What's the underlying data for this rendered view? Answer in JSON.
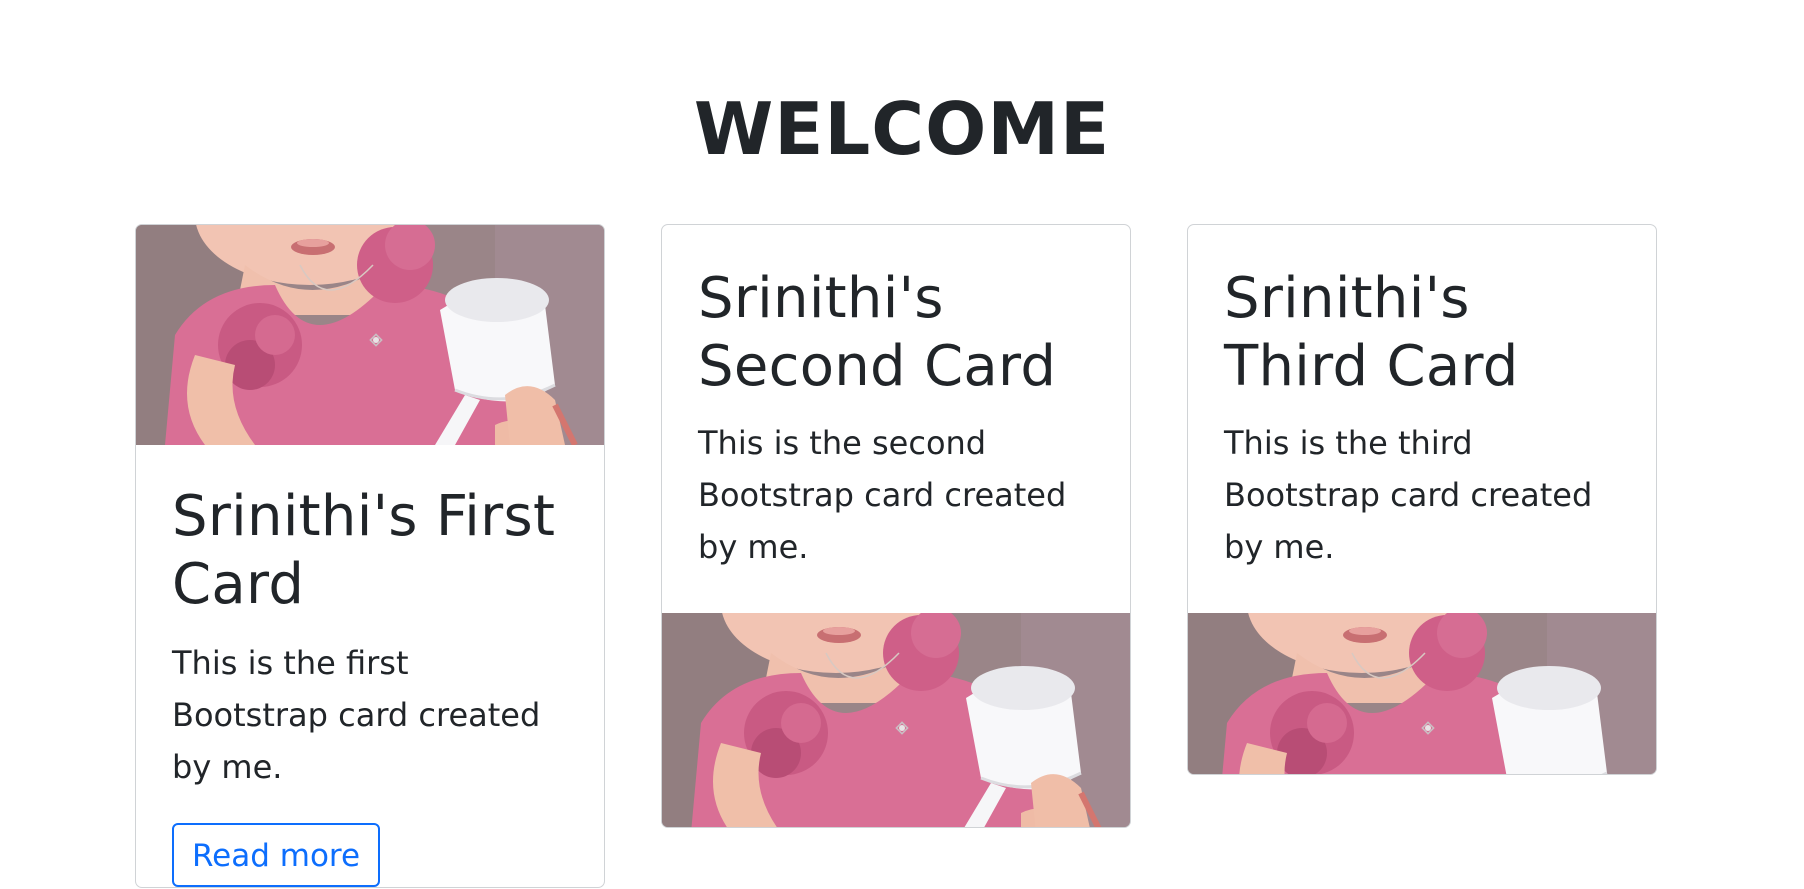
{
  "page": {
    "title": "WELCOME"
  },
  "cards": [
    {
      "title": "Srinithi's First Card",
      "text": "This is the first Bootstrap card created by me.",
      "button_label": "Read more",
      "image_icon": "child-photo-icon"
    },
    {
      "title": "Srinithi's Second Card",
      "text": "This is the second Bootstrap card created by me.",
      "image_icon": "child-photo-icon"
    },
    {
      "title": "Srinithi's Third Card",
      "text": "This is the third Bootstrap card created by me.",
      "image_icon": "child-photo-icon"
    }
  ],
  "colors": {
    "text": "#212529",
    "primary": "#0d6efd",
    "card_border": "#d0d3d6",
    "dress_pink": "#d96f95"
  }
}
